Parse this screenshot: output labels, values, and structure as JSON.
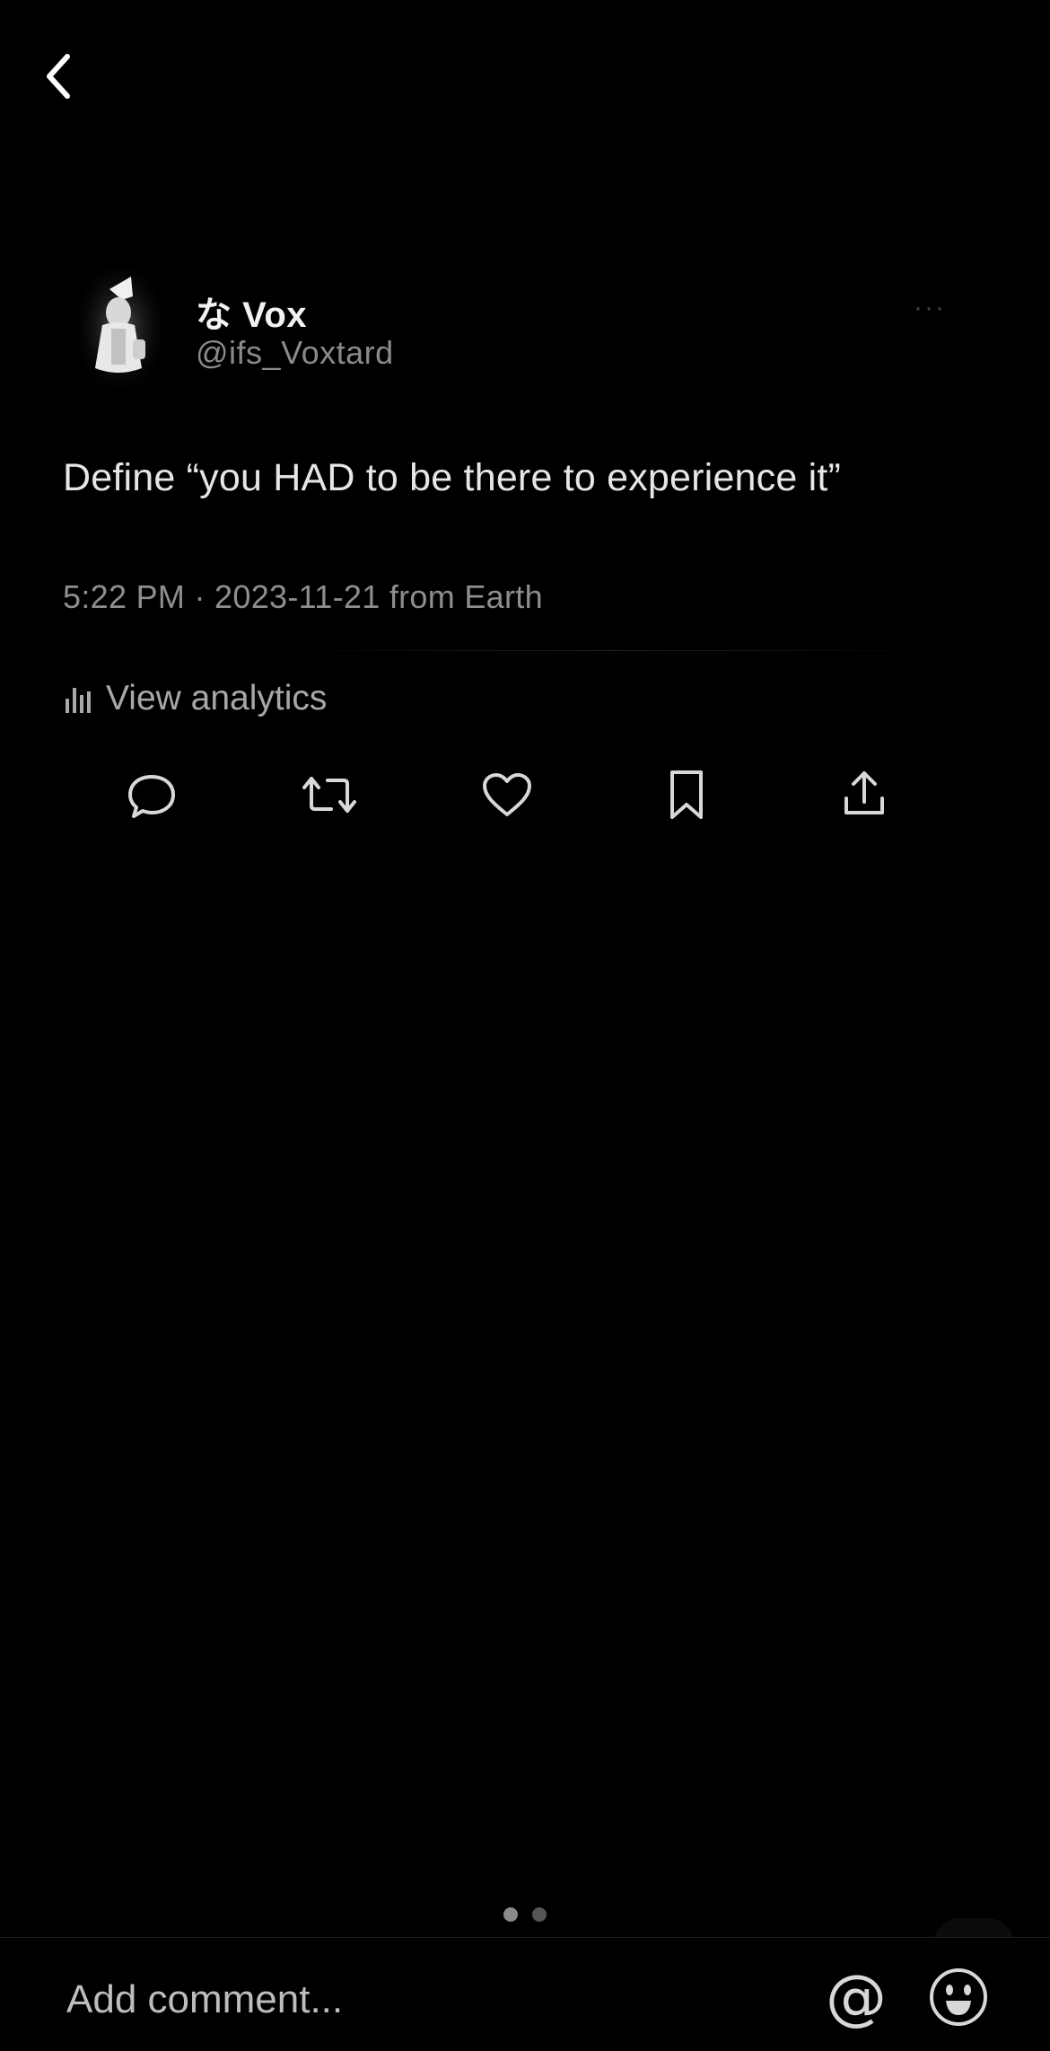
{
  "nav": {
    "back_icon": "chevron-left-icon"
  },
  "post": {
    "display_name": "な Vox",
    "handle": "@ifs_Voxtard",
    "more_label": "···",
    "text": "Define “you HAD to be there to experience it”",
    "timestamp": "5:22 PM · 2023-11-21 from Earth",
    "analytics_label": "View analytics",
    "actions": [
      {
        "icon": "reply-icon"
      },
      {
        "icon": "retweet-icon"
      },
      {
        "icon": "like-icon"
      },
      {
        "icon": "bookmark-icon"
      },
      {
        "icon": "share-icon"
      }
    ]
  },
  "pager": {
    "current": 1,
    "total": 2
  },
  "composer": {
    "placeholder": "Add comment...",
    "mention_label": "@",
    "emoji_icon": "emoji-face-icon"
  },
  "colors": {
    "background": "#000000",
    "primary_text": "#e6e6e6",
    "secondary_text": "#8e8e8e"
  }
}
